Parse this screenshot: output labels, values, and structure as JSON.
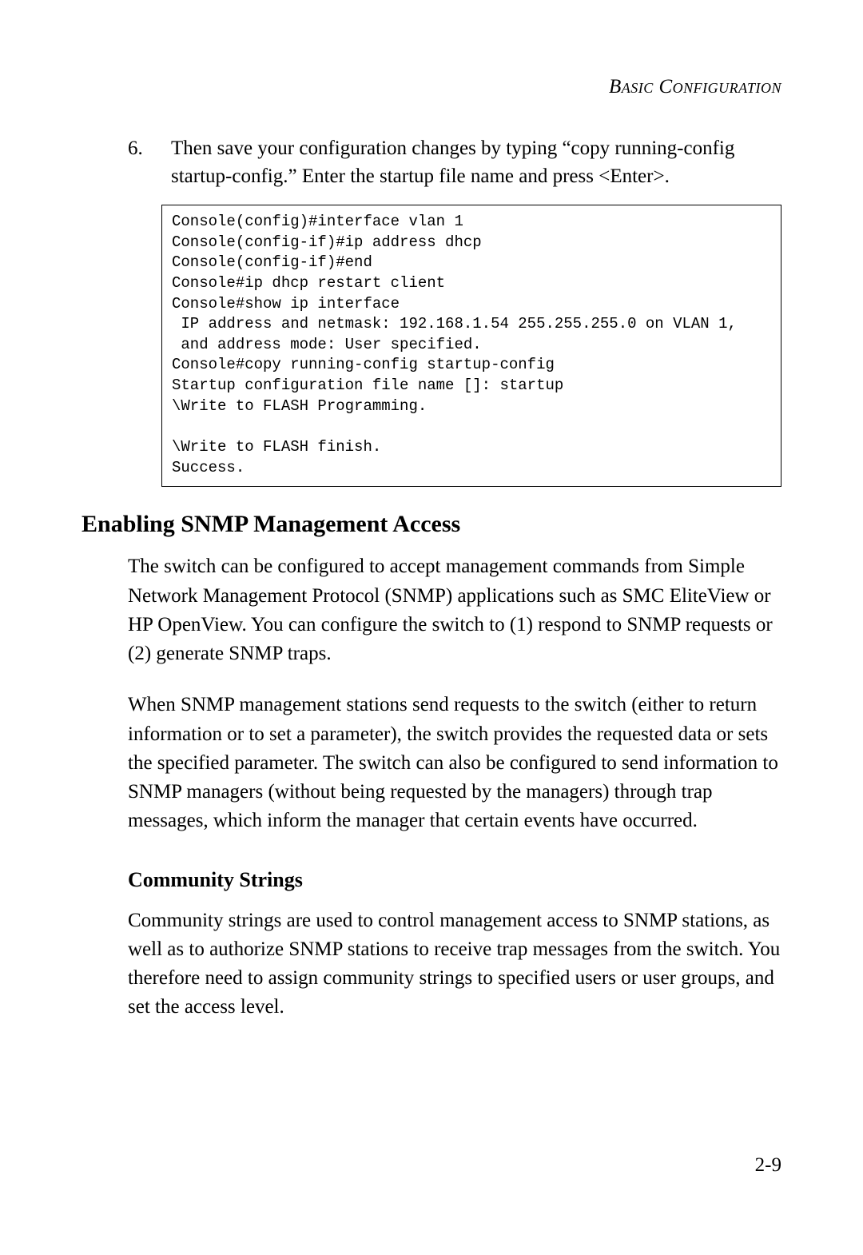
{
  "header": {
    "running_title": "Basic Configuration"
  },
  "step": {
    "number": "6.",
    "text": "Then save your configuration changes by typing “copy running-config startup-config.” Enter the startup file name and press <Enter>."
  },
  "code": "Console(config)#interface vlan 1\nConsole(config-if)#ip address dhcp\nConsole(config-if)#end\nConsole#ip dhcp restart client\nConsole#show ip interface\n IP address and netmask: 192.168.1.54 255.255.255.0 on VLAN 1,\n and address mode: User specified.\nConsole#copy running-config startup-config\nStartup configuration file name []: startup\n\\Write to FLASH Programming.\n\n\\Write to FLASH finish.\nSuccess.",
  "section": {
    "title": "Enabling SNMP Management Access",
    "para1": "The switch can be configured to accept management commands from Simple Network Management Protocol (SNMP) applications such as SMC EliteView or HP OpenView. You can configure the switch to (1) respond to SNMP requests or (2) generate SNMP traps.",
    "para2": "When SNMP management stations send requests to the switch (either to return information or to set a parameter), the switch provides the requested data or sets the specified parameter. The switch can also be configured to send information to SNMP managers (without being requested by the managers) through trap messages, which inform the manager that certain events have occurred."
  },
  "subsection": {
    "title": "Community Strings",
    "para": "Community strings are used to control management access to SNMP stations, as well as to authorize SNMP stations to receive trap messages from the switch. You therefore need to assign community strings to specified users or user groups, and set the access level."
  },
  "page_number": "2-9"
}
